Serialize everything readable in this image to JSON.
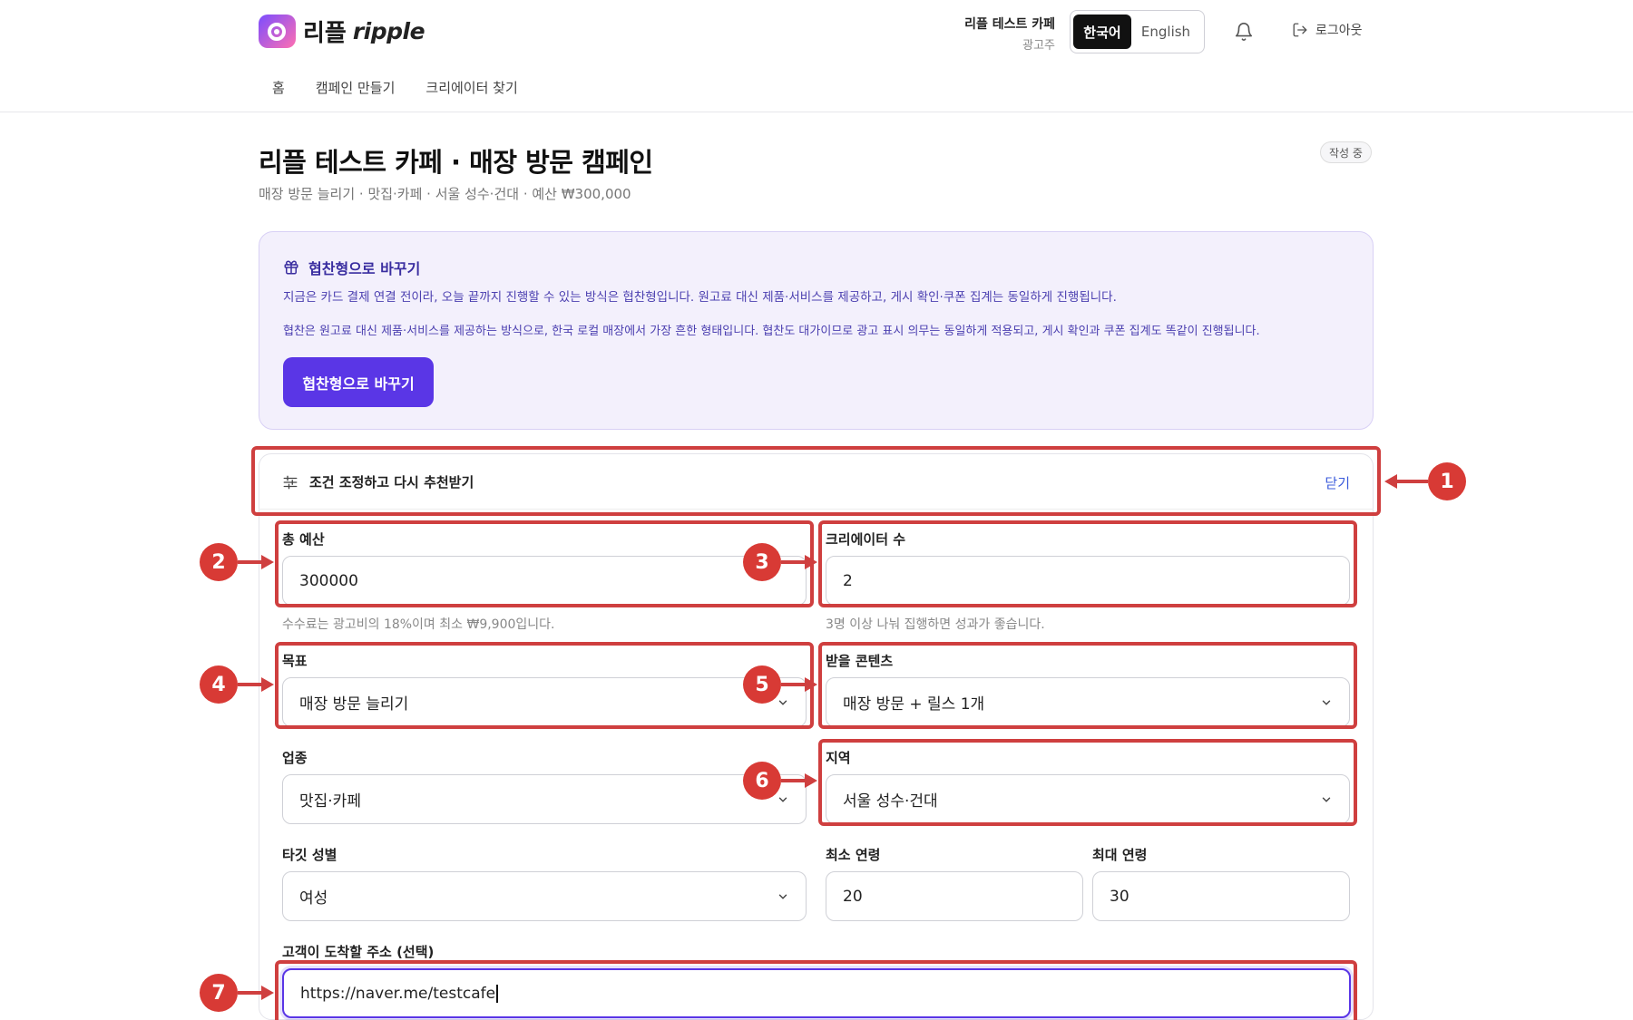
{
  "header": {
    "logo_ko": "리플",
    "logo_en": "ripple",
    "account_name": "리플 테스트 카페",
    "account_role": "광고주",
    "lang_ko": "한국어",
    "lang_en": "English",
    "logout": "로그아웃"
  },
  "nav": {
    "items": [
      "홈",
      "캠페인 만들기",
      "크리에이터 찾기"
    ]
  },
  "page": {
    "title": "리플 테스트 카페 · 매장 방문 캠페인",
    "subtitle": "매장 방문 늘리기 · 맛집·카페 · 서울 성수·건대 · 예산 ₩300,000",
    "status": "작성 중"
  },
  "sponsor": {
    "heading": "협찬형으로 바꾸기",
    "p1": "지금은 카드 결제 연결 전이라, 오늘 끝까지 진행할 수 있는 방식은 협찬형입니다. 원고료 대신 제품·서비스를 제공하고, 게시 확인·쿠폰 집계는 동일하게 진행됩니다.",
    "p2": "협찬은 원고료 대신 제품·서비스를 제공하는 방식으로, 한국 로컬 매장에서 가장 흔한 형태입니다. 협찬도 대가이므로 광고 표시 의무는 동일하게 적용되고, 게시 확인과 쿠폰 집계도 똑같이 진행됩니다.",
    "button": "협찬형으로 바꾸기"
  },
  "adjust": {
    "title": "조건 조정하고 다시 추천받기",
    "close": "닫기"
  },
  "form": {
    "budget_label": "총 예산",
    "budget_value": "300000",
    "budget_hint": "수수료는 광고비의 18%이며 최소 ₩9,900입니다.",
    "creators_label": "크리에이터 수",
    "creators_value": "2",
    "creators_hint": "3명 이상 나눠 집행하면 성과가 좋습니다.",
    "goal_label": "목표",
    "goal_value": "매장 방문 늘리기",
    "content_label": "받을 콘텐츠",
    "content_value": "매장 방문 + 릴스 1개",
    "industry_label": "업종",
    "industry_value": "맛집·카페",
    "region_label": "지역",
    "region_value": "서울 성수·건대",
    "gender_label": "타깃 성별",
    "gender_value": "여성",
    "min_age_label": "최소 연령",
    "min_age_value": "20",
    "max_age_label": "최대 연령",
    "max_age_value": "30",
    "url_label": "고객이 도착할 주소 (선택)",
    "url_value": "https://naver.me/testcafe"
  },
  "annotations": [
    "1",
    "2",
    "3",
    "4",
    "5",
    "6",
    "7"
  ],
  "colors": {
    "accent": "#5a36e6",
    "annotation": "#d83a35",
    "sponsor_bg": "#f3f0fc",
    "link": "#3b5bdb"
  }
}
